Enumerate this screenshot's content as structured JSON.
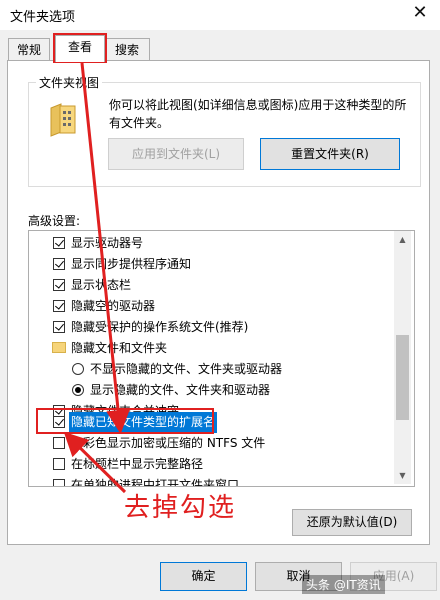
{
  "window": {
    "title": "文件夹选项",
    "close_glyph": "✕"
  },
  "tabs": [
    {
      "label": "常规",
      "active": false
    },
    {
      "label": "查看",
      "active": true
    },
    {
      "label": "搜索",
      "active": false
    }
  ],
  "folder_view": {
    "group_title": "文件夹视图",
    "description": "你可以将此视图(如详细信息或图标)应用于这种类型的所有文件夹。",
    "apply_button": "应用到文件夹(L)",
    "reset_button": "重置文件夹(R)"
  },
  "advanced": {
    "label": "高级设置:",
    "items": [
      {
        "kind": "checkbox",
        "checked": true,
        "label": "显示驱动器号"
      },
      {
        "kind": "checkbox",
        "checked": true,
        "label": "显示同步提供程序通知"
      },
      {
        "kind": "checkbox",
        "checked": true,
        "label": "显示状态栏"
      },
      {
        "kind": "checkbox",
        "checked": true,
        "label": "隐藏空的驱动器"
      },
      {
        "kind": "checkbox",
        "checked": true,
        "label": "隐藏受保护的操作系统文件(推荐)"
      },
      {
        "kind": "folder",
        "checked": false,
        "label": "隐藏文件和文件夹"
      },
      {
        "kind": "radio",
        "checked": false,
        "label": "不显示隐藏的文件、文件夹或驱动器"
      },
      {
        "kind": "radio",
        "checked": true,
        "label": "显示隐藏的文件、文件夹和驱动器"
      },
      {
        "kind": "checkbox",
        "checked": true,
        "label": "隐藏文件夹合并冲突"
      },
      {
        "kind": "checkbox",
        "checked": true,
        "label": "隐藏已知文件类型的扩展名",
        "selected": true
      },
      {
        "kind": "checkbox",
        "checked": false,
        "label": "用彩色显示加密或压缩的 NTFS 文件"
      },
      {
        "kind": "checkbox",
        "checked": false,
        "label": "在标题栏中显示完整路径"
      },
      {
        "kind": "checkbox",
        "checked": false,
        "label": "在单独的进程中打开文件夹窗口"
      }
    ]
  },
  "restore_button": "还原为默认值(D)",
  "footer": {
    "ok": "确定",
    "cancel": "取消",
    "apply": "应用(A)"
  },
  "annotation": {
    "text": "去掉勾选",
    "color": "#e02020"
  },
  "watermark": "头条 @IT资讯"
}
